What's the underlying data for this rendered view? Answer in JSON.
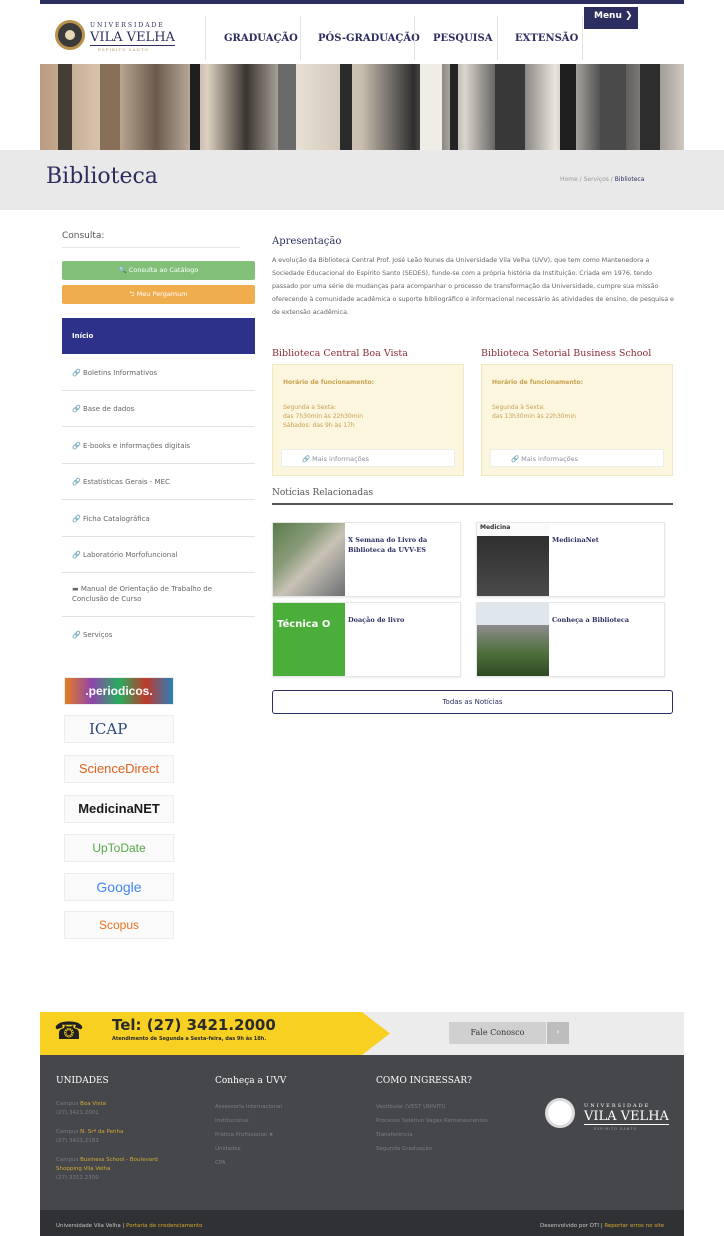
{
  "header": {
    "logo_top": "UNIVERSIDADE",
    "logo_main": "VILA VELHA",
    "logo_sub": "ESPIRITO SANTO",
    "nav": [
      "GRADUAÇÃO",
      "PÓS-GRADUAÇÃO",
      "PESQUISA",
      "EXTENSÃO"
    ],
    "menu_label": "Menu ❯"
  },
  "page": {
    "title": "Biblioteca",
    "breadcrumb": [
      "Home",
      "Serviços",
      "Biblioteca"
    ],
    "breadcrumb_sep": "/"
  },
  "sidebar": {
    "consulta_label": "Consulta:",
    "catalogo_button": "🔍 Consulta ao Catálogo",
    "pergamum_button": "⮌ Meu Pergamum",
    "items": [
      {
        "label": "Início",
        "active": true
      },
      {
        "label": "Boletins Informativos",
        "icon": "link-icon"
      },
      {
        "label": "Base de dados",
        "icon": "link-icon"
      },
      {
        "label": "E-books e informações digitais",
        "icon": "link-icon"
      },
      {
        "label": "Estatísticas Gerais - MEC",
        "icon": "link-icon"
      },
      {
        "label": "Ficha Catalográfica",
        "icon": "link-icon"
      },
      {
        "label": "Laboratório Morfofuncional",
        "icon": "link-icon"
      },
      {
        "label": "Manual de Orientação de Trabalho de Conclusão de Curso",
        "icon": "document-icon"
      },
      {
        "label": "Serviços",
        "icon": "link-icon"
      }
    ],
    "partner_logos": [
      ".periodicos.",
      "ICAP",
      "ScienceDirect",
      "MedicinaNET",
      "UpToDate",
      "Google",
      "Scopus"
    ]
  },
  "main": {
    "apresentacao_title": "Apresentação",
    "apresentacao_text": "A evolução da Biblioteca Central Prof. José Leão Nunes da Universidade Vila Velha (UVV), que tem como Mantenedora a Sociedade Educacional do Espírito Santo (SEDES), funde-se com a própria história da Instituição. Criada em 1976, tendo passado por uma série de mudanças para acompanhar o processo de transformação da Universidade, cumpre sua missão oferecendo à comunidade acadêmica o suporte bibliográfico e informacional necessário às atividades de ensino, de pesquisa e de extensão acadêmica.",
    "libraries": [
      {
        "name": "Biblioteca Central Boa Vista",
        "hours_label": "Horário de funcionamento:",
        "lines": [
          "Segunda a Sexta:",
          "das 7h30min às 22h30min",
          "Sábados: das 9h às 17h"
        ],
        "more": "Mais informações"
      },
      {
        "name": "Biblioteca Setorial Business School",
        "hours_label": "Horário de funcionamento:",
        "lines": [
          "Segunda à Sexta:",
          "das 13h30min às 22h30min"
        ],
        "more": "Mais informações"
      }
    ],
    "news_title": "Notícias Relacionadas",
    "news": [
      {
        "title": "X Semana do Livro da Biblioteca da UVV-ES",
        "thumb_text": ""
      },
      {
        "title": "MedicinaNet",
        "thumb_text": "Medicina"
      },
      {
        "title": "Doação de livro",
        "thumb_text": "Técnica O"
      },
      {
        "title": "Conheça a Biblioteca",
        "thumb_text": ""
      }
    ],
    "all_news_button": "Todas as Notícias"
  },
  "contact": {
    "phone": "Tel: (27) 3421.2000",
    "hours": "Atendimento de Segunda a Sexta-feira, das 9h às 18h.",
    "fale_conosco": "Fale Conosco",
    "arrow": "›"
  },
  "footer": {
    "unidades_title": "UNIDADES",
    "unidades": [
      {
        "prefix": "Campus ",
        "name": "Boa Vista",
        "phone": "(27) 3421.2001"
      },
      {
        "prefix": "Campus ",
        "name": "N. Srª da Penha",
        "phone": "(27) 3421.2183"
      },
      {
        "prefix": "Campus ",
        "name": "Business School - Boulevard Shopping Vila Velha",
        "phone": "(27) 3311.2300"
      }
    ],
    "conheca_title": "Conheça a UVV",
    "conheca_links": [
      "Assessoria Internacional",
      "Institucional",
      "Prática Profissional ★",
      "Unidades",
      "CPA"
    ],
    "ingressar_title": "COMO INGRESSAR?",
    "ingressar_links": [
      "Vestibular (VEST UNIVITI)",
      "Processo Seletivo Vagas Remanescentes",
      "Transferência",
      "Segunda Graduação"
    ],
    "logo_top": "UNIVERSIDADE",
    "logo_main": "VILA VELHA",
    "logo_sub": "ESPIRITO SANTO",
    "bottom_left": "Universidade Vila Velha | ",
    "bottom_left_link": "Portaria de credenciamento",
    "bottom_right": "Desenvolvido por DTI | ",
    "bottom_right_link": "Reportar erros no site"
  },
  "colors": {
    "brand_navy": "#2b2e5f",
    "active_sidebar": "#2e318a",
    "catalogo_green": "#82c07a",
    "pergamum_orange": "#f0ad4e",
    "library_title": "#8b2a3b",
    "phone_yellow": "#f7d021",
    "footer_dark": "#45474b"
  }
}
